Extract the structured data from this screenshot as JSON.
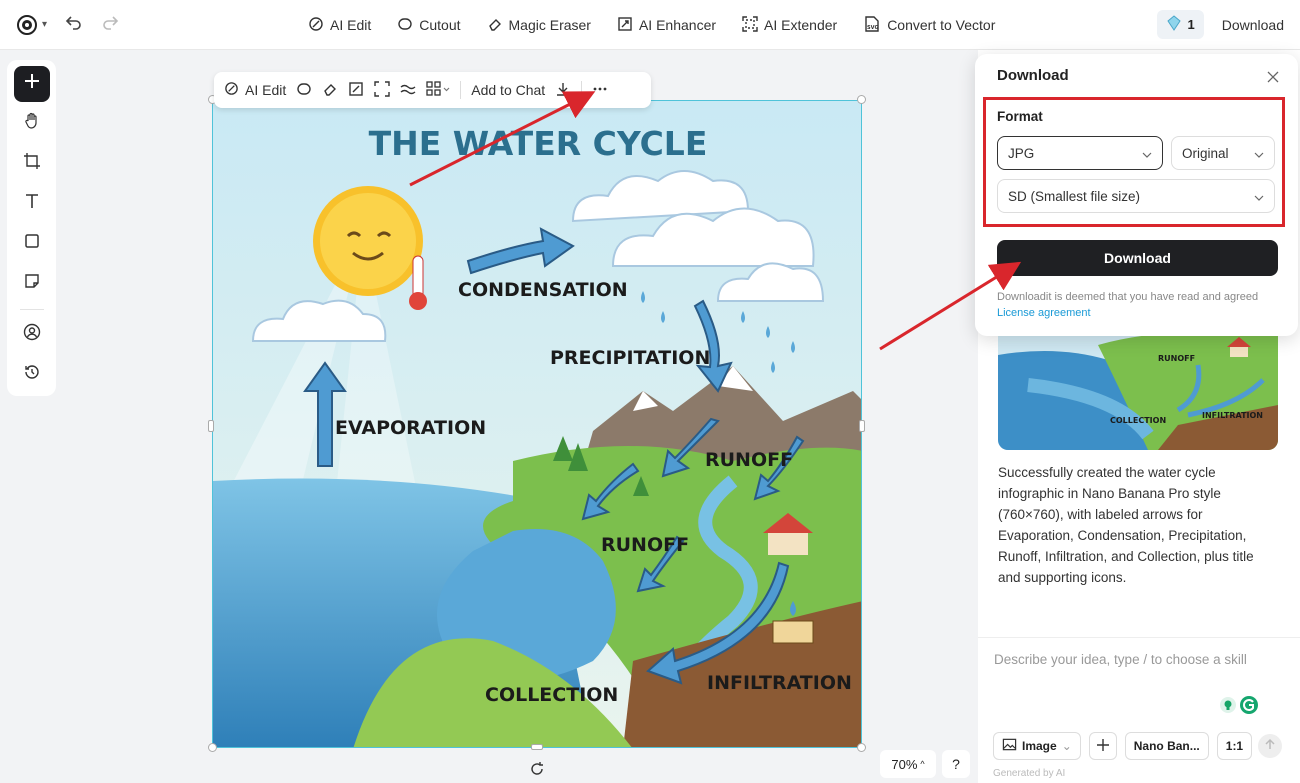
{
  "topbar": {
    "tools": [
      {
        "label": "AI Edit",
        "icon": "ai-edit-icon"
      },
      {
        "label": "Cutout",
        "icon": "cutout-icon"
      },
      {
        "label": "Magic Eraser",
        "icon": "eraser-icon"
      },
      {
        "label": "AI Enhancer",
        "icon": "enhancer-icon"
      },
      {
        "label": "AI Extender",
        "icon": "extender-icon"
      },
      {
        "label": "Convert to Vector",
        "icon": "vector-icon"
      }
    ],
    "credits": "1",
    "download_label": "Download"
  },
  "floating_toolbar": {
    "ai_edit": "AI Edit",
    "add_to_chat": "Add to Chat"
  },
  "image": {
    "title": "THE WATER CYCLE",
    "labels": {
      "condensation": "CONDENSATION",
      "precipitation": "PRECIPITATION",
      "evaporation": "EVAPORATION",
      "runoff_top": "RUNOFF",
      "runoff_bottom": "RUNOFF",
      "collection": "COLLECTION",
      "infiltration": "INFILTRATION"
    }
  },
  "zoom": "70%",
  "help": "?",
  "dialog": {
    "title": "Download",
    "format_label": "Format",
    "format_value": "JPG",
    "size_value": "Original",
    "quality_value": "SD (Smallest file size)",
    "download_button": "Download",
    "note": "Downloadit is deemed that you have read and agreed",
    "license": "License agreement"
  },
  "thumbnail": {
    "labels": {
      "runoff": "RUNOFF",
      "collection": "COLLECTION",
      "infiltration": "INFILTRATION"
    }
  },
  "chat": {
    "message": "Successfully created the water cycle infographic in Nano Banana Pro style (760×760), with labeled arrows for Evaporation, Condensation, Precipitation, Runoff, Infiltration, and Collection, plus title and supporting icons.",
    "placeholder": "Describe your idea, type / to choose a skill",
    "mode": "Image",
    "model": "Nano Ban...",
    "ratio": "1:1",
    "generated": "Generated by AI"
  },
  "colors": {
    "accent_red": "#d9262c",
    "dark_button": "#1f2023",
    "link": "#1a9ad6",
    "selection": "#4fc3d9"
  }
}
